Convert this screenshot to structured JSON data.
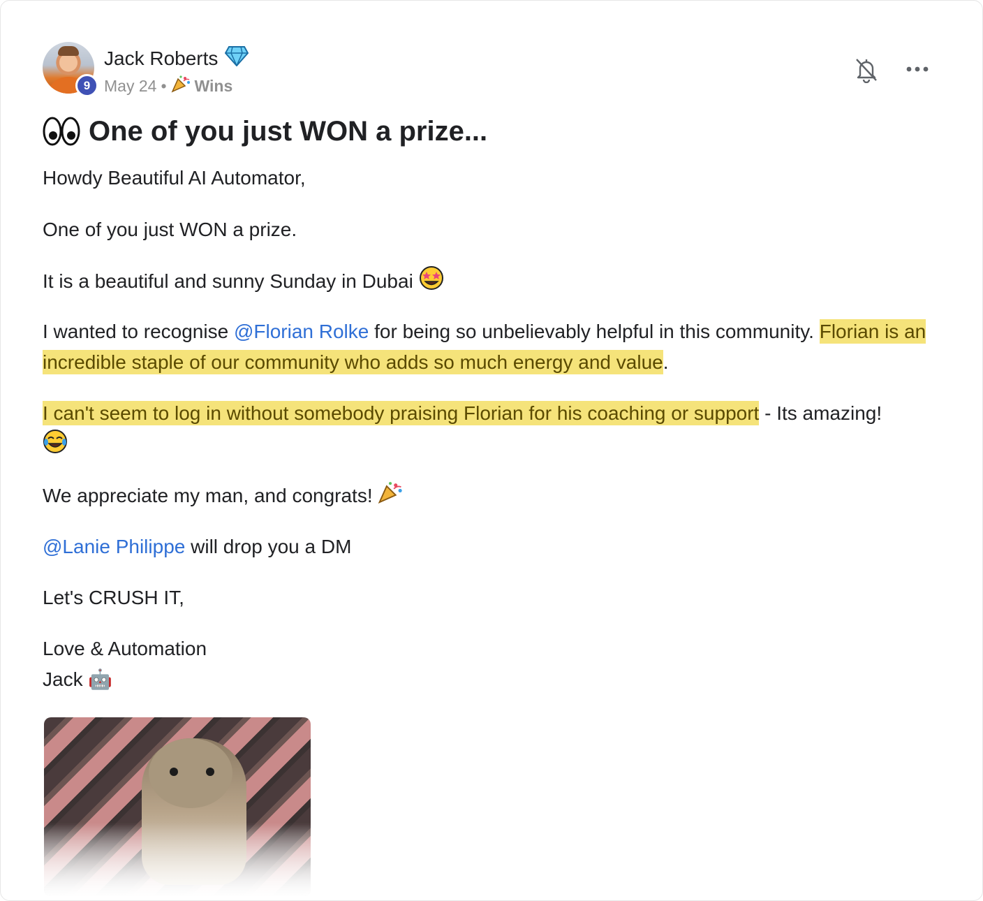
{
  "post": {
    "author": "Jack Roberts",
    "author_badge": "diamond-icon",
    "level": "9",
    "date": "May 24",
    "separator": "•",
    "category": "Wins",
    "category_icon": "party-popper-icon",
    "title_emoji": "eyes-icon",
    "title": "One of you just WON a prize..."
  },
  "body": {
    "p1": "Howdy Beautiful AI Automator,",
    "p2": "One of you just WON a prize.",
    "p3": "It is a beautiful and sunny Sunday in Dubai",
    "p4_a": "I wanted to recognise ",
    "p4_mention": "@Florian Rolke",
    "p4_b": " for being so unbelievably helpful in this community. ",
    "p4_highlight": "Florian is an incredible staple of our community who adds so much energy and value",
    "p4_c": ".",
    "p5_highlight": "I can't seem to log in without somebody praising Florian for his coaching or support",
    "p5_b": " - Its amazing!",
    "p6": "We appreciate my man, and congrats!",
    "p7_mention": "@Lanie Philippe",
    "p7_b": " will drop you a DM",
    "p8": "Let's CRUSH IT,",
    "p9": "Love & Automation",
    "p10": "Jack 🤖"
  },
  "colors": {
    "mention": "#2f6fd6",
    "highlight": "#f5e37a",
    "level_badge": "#3f51b5"
  }
}
